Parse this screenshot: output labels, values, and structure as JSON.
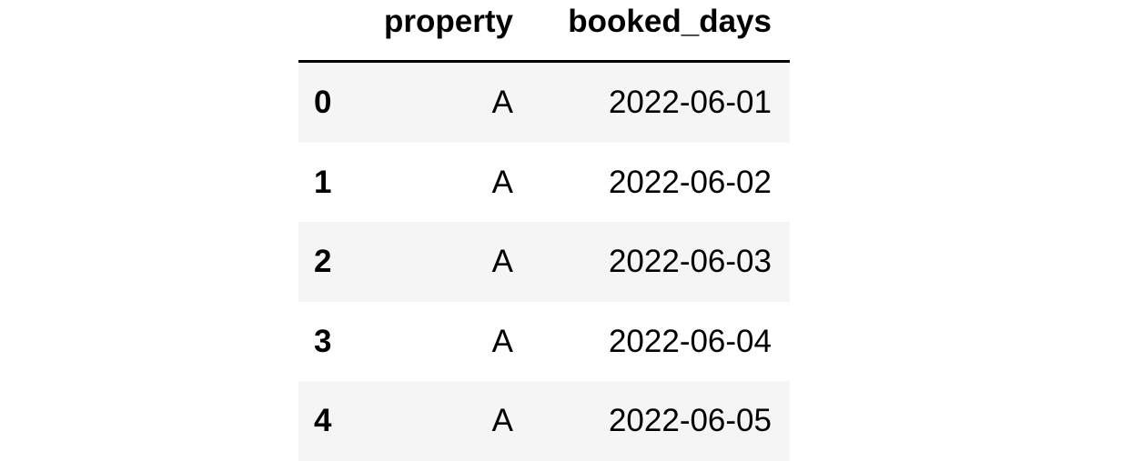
{
  "table": {
    "columns": [
      "property",
      "booked_days"
    ],
    "rows": [
      {
        "index": "0",
        "property": "A",
        "booked_days": "2022-06-01"
      },
      {
        "index": "1",
        "property": "A",
        "booked_days": "2022-06-02"
      },
      {
        "index": "2",
        "property": "A",
        "booked_days": "2022-06-03"
      },
      {
        "index": "3",
        "property": "A",
        "booked_days": "2022-06-04"
      },
      {
        "index": "4",
        "property": "A",
        "booked_days": "2022-06-05"
      }
    ]
  },
  "colors": {
    "striped_row": "#f5f5f5",
    "header_rule": "#000000"
  }
}
